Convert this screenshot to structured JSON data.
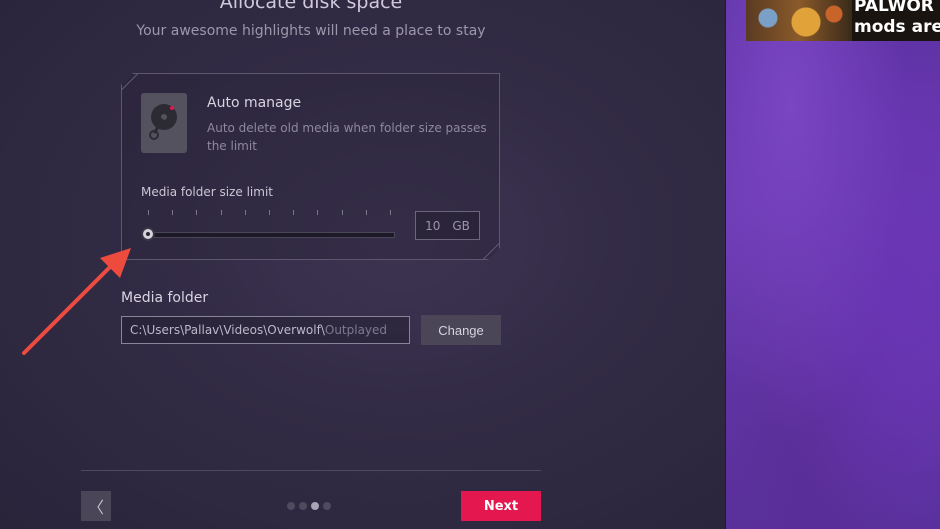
{
  "header": {
    "title": "Allocate disk space",
    "subtitle": "Your awesome highlights will need a place to stay"
  },
  "auto_manage": {
    "title": "Auto manage",
    "description": "Auto delete old media when folder size passes the limit",
    "icon": "hard-drive-icon"
  },
  "size_limit": {
    "label": "Media folder size limit",
    "value": "10",
    "unit": "GB",
    "slider_fraction": 0.0,
    "tick_count": 11
  },
  "media_folder": {
    "label": "Media folder",
    "path_base": "C:\\Users\\Pallav\\Videos\\Overwolf\\",
    "path_leaf": "Outplayed",
    "change_label": "Change"
  },
  "footer": {
    "back_label": "〈",
    "next_label": "Next",
    "page_count": 4,
    "active_page": 3
  },
  "promo": {
    "line1": "PALWOR",
    "line2": "mods are h"
  },
  "colors": {
    "accent": "#e5174f",
    "annotation": "#ee4b3f",
    "purple_bg": "#6b3ab3"
  }
}
